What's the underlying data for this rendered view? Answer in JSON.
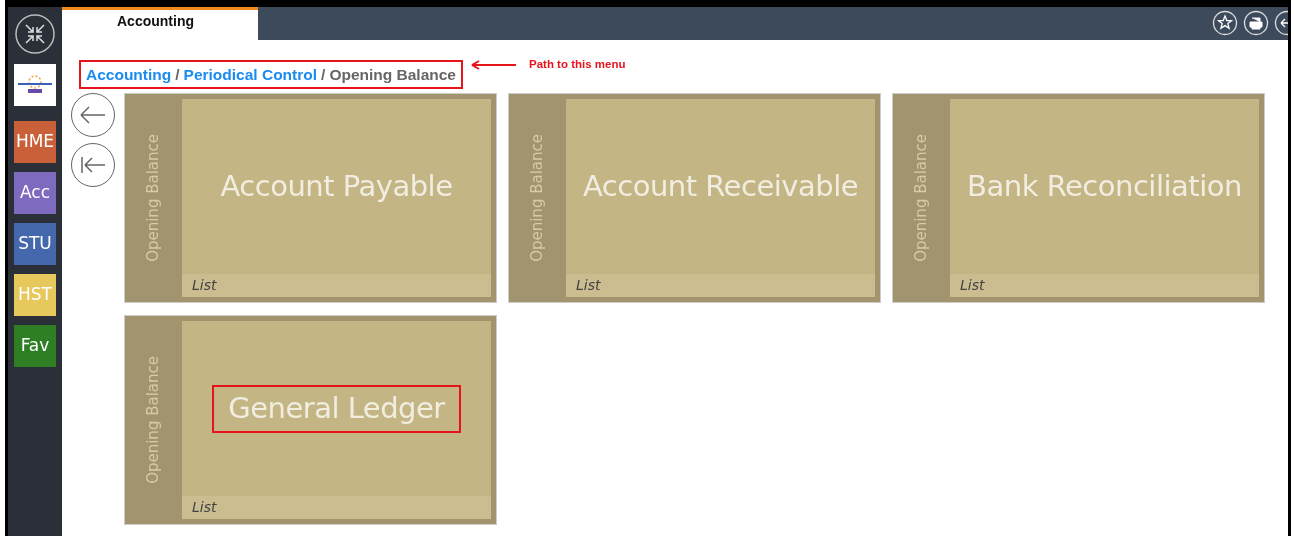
{
  "tab": {
    "label": "Accounting",
    "selected": true
  },
  "header_icons": [
    {
      "kind": "star"
    },
    {
      "kind": "print"
    },
    {
      "kind": "back"
    }
  ],
  "sidebar": {
    "items": [
      {
        "label": "HME",
        "color": "#c9603a"
      },
      {
        "label": "Acc",
        "color": "#7e6bbf"
      },
      {
        "label": "STU",
        "color": "#4568ad"
      },
      {
        "label": "HST",
        "color": "#e6c85c"
      },
      {
        "label": "Fav",
        "color": "#2e7f24"
      }
    ]
  },
  "breadcrumb": {
    "highlighted": true,
    "separator": "/",
    "items": [
      {
        "label": "Accounting",
        "link": true
      },
      {
        "label": "Periodical Control",
        "link": true
      },
      {
        "label": "Opening Balance",
        "link": false
      }
    ]
  },
  "annotation": {
    "text": "Path to this menu"
  },
  "nav_buttons": [
    {
      "kind": "back"
    },
    {
      "kind": "first"
    }
  ],
  "tiles": [
    {
      "side_label": "Opening Balance",
      "title": "Account Payable",
      "footer": "List",
      "highlighted": false
    },
    {
      "side_label": "Opening Balance",
      "title": "Account Receivable",
      "footer": "List",
      "highlighted": false
    },
    {
      "side_label": "Opening Balance",
      "title": "Bank Reconciliation",
      "footer": "List",
      "highlighted": false
    },
    {
      "side_label": "Opening Balance",
      "title": "General Ledger",
      "footer": "List",
      "highlighted": true
    }
  ]
}
